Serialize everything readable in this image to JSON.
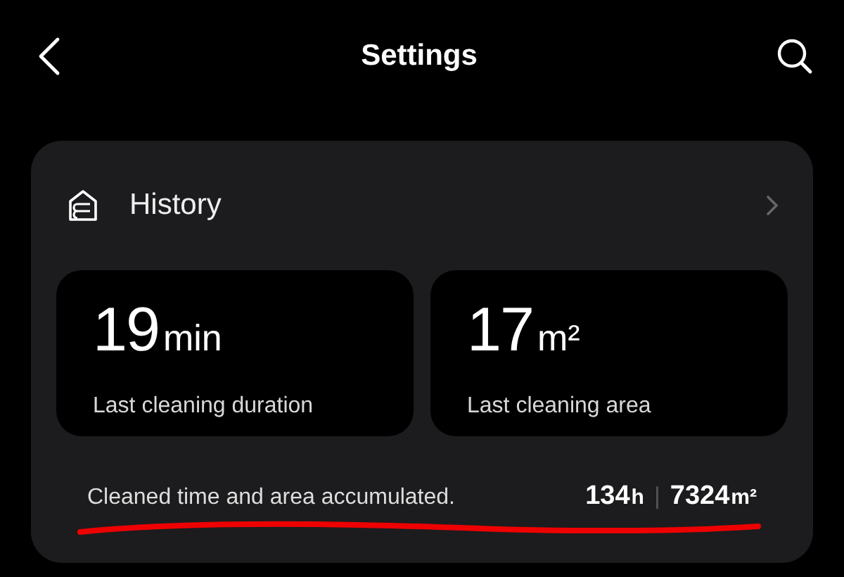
{
  "header": {
    "title": "Settings"
  },
  "history": {
    "title": "History",
    "stats": [
      {
        "value": "19",
        "unit": "min",
        "label": "Last cleaning duration"
      },
      {
        "value": "17",
        "unit": "m²",
        "label": "Last cleaning area"
      }
    ],
    "summary": {
      "text": "Cleaned time and area accumulated.",
      "time_value": "134",
      "time_unit": "h",
      "separator": "|",
      "area_value": "7324",
      "area_unit": "m²"
    }
  }
}
